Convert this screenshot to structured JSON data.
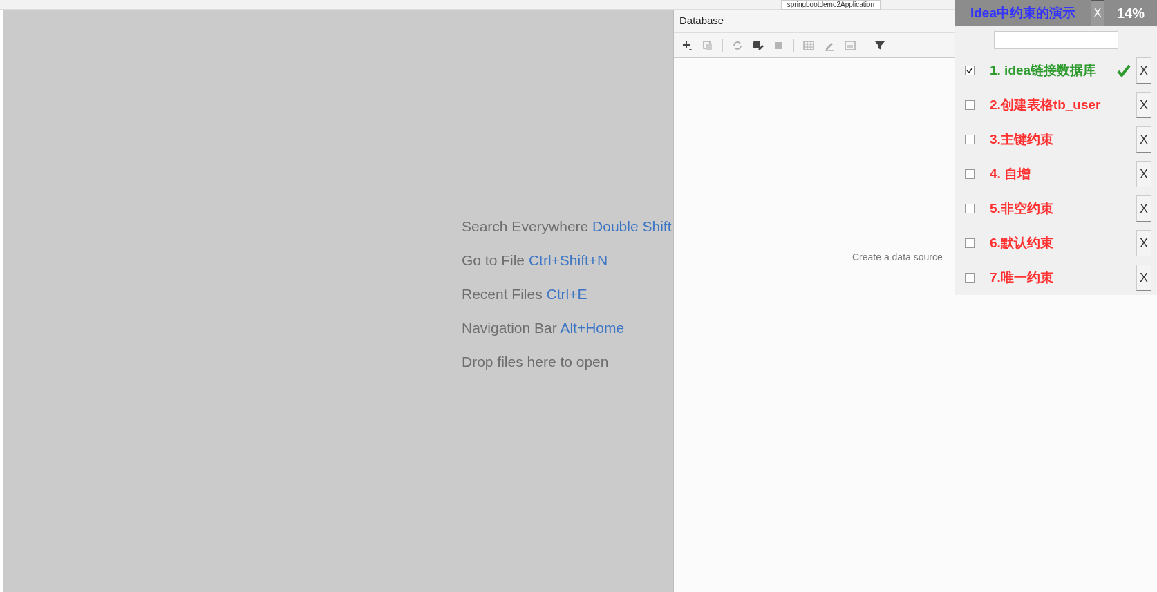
{
  "run_config": {
    "label": "springbootdemo2Application"
  },
  "editor_hints": [
    {
      "action": "Search Everywhere",
      "shortcut": "Double Shift"
    },
    {
      "action": "Go to File",
      "shortcut": "Ctrl+Shift+N"
    },
    {
      "action": "Recent Files",
      "shortcut": "Ctrl+E"
    },
    {
      "action": "Navigation Bar",
      "shortcut": "Alt+Home"
    },
    {
      "action": "Drop files here to open"
    }
  ],
  "database_panel": {
    "title": "Database",
    "empty_text": "Create a data source"
  },
  "checklist_window": {
    "title": "Idea中约束的演示",
    "close_label": "X",
    "progress": "14%",
    "items": [
      {
        "label": "1. idea链接数据库",
        "checked": true,
        "color": "#2e9b2e",
        "remove_label": "X"
      },
      {
        "label": "2.创建表格tb_user",
        "checked": false,
        "color": "#ff3030",
        "remove_label": "X"
      },
      {
        "label": "3.主键约束",
        "checked": false,
        "color": "#ff3030",
        "remove_label": "X"
      },
      {
        "label": "4. 自增",
        "checked": false,
        "color": "#ff3030",
        "remove_label": "X"
      },
      {
        "label": "5.非空约束",
        "checked": false,
        "color": "#ff3030",
        "remove_label": "X"
      },
      {
        "label": "6.默认约束",
        "checked": false,
        "color": "#ff3030",
        "remove_label": "X"
      },
      {
        "label": "7.唯一约束",
        "checked": false,
        "color": "#ff3030",
        "remove_label": "X"
      }
    ]
  }
}
